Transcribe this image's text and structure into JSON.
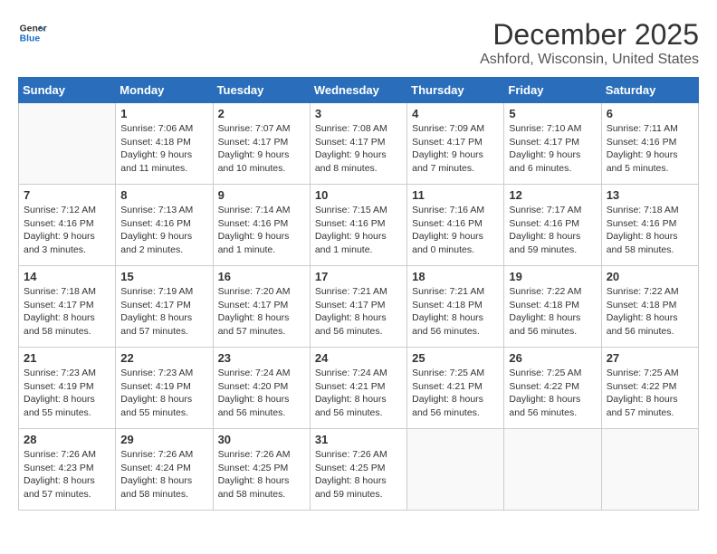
{
  "logo": {
    "line1": "General",
    "line2": "Blue"
  },
  "title": "December 2025",
  "subtitle": "Ashford, Wisconsin, United States",
  "days_header": [
    "Sunday",
    "Monday",
    "Tuesday",
    "Wednesday",
    "Thursday",
    "Friday",
    "Saturday"
  ],
  "weeks": [
    [
      {
        "day": "",
        "info": ""
      },
      {
        "day": "1",
        "info": "Sunrise: 7:06 AM\nSunset: 4:18 PM\nDaylight: 9 hours\nand 11 minutes."
      },
      {
        "day": "2",
        "info": "Sunrise: 7:07 AM\nSunset: 4:17 PM\nDaylight: 9 hours\nand 10 minutes."
      },
      {
        "day": "3",
        "info": "Sunrise: 7:08 AM\nSunset: 4:17 PM\nDaylight: 9 hours\nand 8 minutes."
      },
      {
        "day": "4",
        "info": "Sunrise: 7:09 AM\nSunset: 4:17 PM\nDaylight: 9 hours\nand 7 minutes."
      },
      {
        "day": "5",
        "info": "Sunrise: 7:10 AM\nSunset: 4:17 PM\nDaylight: 9 hours\nand 6 minutes."
      },
      {
        "day": "6",
        "info": "Sunrise: 7:11 AM\nSunset: 4:16 PM\nDaylight: 9 hours\nand 5 minutes."
      }
    ],
    [
      {
        "day": "7",
        "info": "Sunrise: 7:12 AM\nSunset: 4:16 PM\nDaylight: 9 hours\nand 3 minutes."
      },
      {
        "day": "8",
        "info": "Sunrise: 7:13 AM\nSunset: 4:16 PM\nDaylight: 9 hours\nand 2 minutes."
      },
      {
        "day": "9",
        "info": "Sunrise: 7:14 AM\nSunset: 4:16 PM\nDaylight: 9 hours\nand 1 minute."
      },
      {
        "day": "10",
        "info": "Sunrise: 7:15 AM\nSunset: 4:16 PM\nDaylight: 9 hours\nand 1 minute."
      },
      {
        "day": "11",
        "info": "Sunrise: 7:16 AM\nSunset: 4:16 PM\nDaylight: 9 hours\nand 0 minutes."
      },
      {
        "day": "12",
        "info": "Sunrise: 7:17 AM\nSunset: 4:16 PM\nDaylight: 8 hours\nand 59 minutes."
      },
      {
        "day": "13",
        "info": "Sunrise: 7:18 AM\nSunset: 4:16 PM\nDaylight: 8 hours\nand 58 minutes."
      }
    ],
    [
      {
        "day": "14",
        "info": "Sunrise: 7:18 AM\nSunset: 4:17 PM\nDaylight: 8 hours\nand 58 minutes."
      },
      {
        "day": "15",
        "info": "Sunrise: 7:19 AM\nSunset: 4:17 PM\nDaylight: 8 hours\nand 57 minutes."
      },
      {
        "day": "16",
        "info": "Sunrise: 7:20 AM\nSunset: 4:17 PM\nDaylight: 8 hours\nand 57 minutes."
      },
      {
        "day": "17",
        "info": "Sunrise: 7:21 AM\nSunset: 4:17 PM\nDaylight: 8 hours\nand 56 minutes."
      },
      {
        "day": "18",
        "info": "Sunrise: 7:21 AM\nSunset: 4:18 PM\nDaylight: 8 hours\nand 56 minutes."
      },
      {
        "day": "19",
        "info": "Sunrise: 7:22 AM\nSunset: 4:18 PM\nDaylight: 8 hours\nand 56 minutes."
      },
      {
        "day": "20",
        "info": "Sunrise: 7:22 AM\nSunset: 4:18 PM\nDaylight: 8 hours\nand 56 minutes."
      }
    ],
    [
      {
        "day": "21",
        "info": "Sunrise: 7:23 AM\nSunset: 4:19 PM\nDaylight: 8 hours\nand 55 minutes."
      },
      {
        "day": "22",
        "info": "Sunrise: 7:23 AM\nSunset: 4:19 PM\nDaylight: 8 hours\nand 55 minutes."
      },
      {
        "day": "23",
        "info": "Sunrise: 7:24 AM\nSunset: 4:20 PM\nDaylight: 8 hours\nand 56 minutes."
      },
      {
        "day": "24",
        "info": "Sunrise: 7:24 AM\nSunset: 4:21 PM\nDaylight: 8 hours\nand 56 minutes."
      },
      {
        "day": "25",
        "info": "Sunrise: 7:25 AM\nSunset: 4:21 PM\nDaylight: 8 hours\nand 56 minutes."
      },
      {
        "day": "26",
        "info": "Sunrise: 7:25 AM\nSunset: 4:22 PM\nDaylight: 8 hours\nand 56 minutes."
      },
      {
        "day": "27",
        "info": "Sunrise: 7:25 AM\nSunset: 4:22 PM\nDaylight: 8 hours\nand 57 minutes."
      }
    ],
    [
      {
        "day": "28",
        "info": "Sunrise: 7:26 AM\nSunset: 4:23 PM\nDaylight: 8 hours\nand 57 minutes."
      },
      {
        "day": "29",
        "info": "Sunrise: 7:26 AM\nSunset: 4:24 PM\nDaylight: 8 hours\nand 58 minutes."
      },
      {
        "day": "30",
        "info": "Sunrise: 7:26 AM\nSunset: 4:25 PM\nDaylight: 8 hours\nand 58 minutes."
      },
      {
        "day": "31",
        "info": "Sunrise: 7:26 AM\nSunset: 4:25 PM\nDaylight: 8 hours\nand 59 minutes."
      },
      {
        "day": "",
        "info": ""
      },
      {
        "day": "",
        "info": ""
      },
      {
        "day": "",
        "info": ""
      }
    ]
  ]
}
